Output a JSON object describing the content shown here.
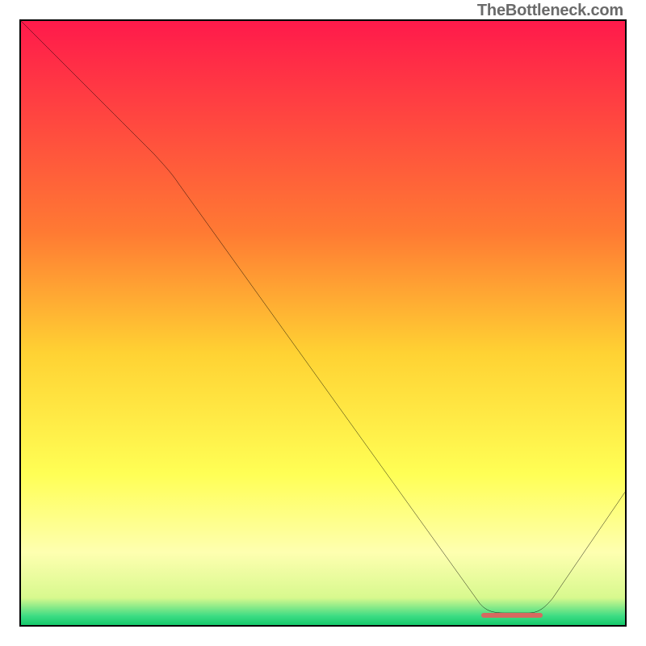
{
  "watermark": "TheBottleneck.com",
  "chart_data": {
    "type": "line",
    "title": "",
    "xlabel": "",
    "ylabel": "",
    "xlim": [
      0,
      100
    ],
    "ylim": [
      0,
      100
    ],
    "grid": false,
    "legend": false,
    "background_gradient": {
      "stops": [
        {
          "pos": 0.0,
          "color": "#ff1a4b"
        },
        {
          "pos": 0.35,
          "color": "#ff7a33"
        },
        {
          "pos": 0.55,
          "color": "#ffd233"
        },
        {
          "pos": 0.75,
          "color": "#ffff55"
        },
        {
          "pos": 0.88,
          "color": "#feffb0"
        },
        {
          "pos": 0.955,
          "color": "#d8f98e"
        },
        {
          "pos": 0.985,
          "color": "#3ddc84"
        },
        {
          "pos": 1.0,
          "color": "#15c96a"
        }
      ]
    },
    "series": [
      {
        "name": "curve",
        "x": [
          0,
          22,
          78,
          85,
          100
        ],
        "y": [
          100,
          78,
          2,
          2,
          22
        ]
      }
    ],
    "valley_marker": {
      "x_start": 77,
      "x_end": 86,
      "y": 2.5,
      "color": "#d66a60"
    }
  }
}
